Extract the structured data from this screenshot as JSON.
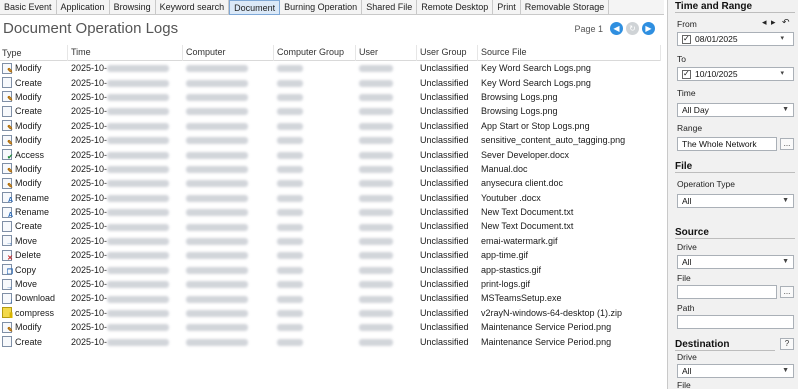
{
  "tabs": [
    "Basic Event",
    "Application",
    "Browsing",
    "Keyword search",
    "Document",
    "Burning Operation",
    "Shared File",
    "Remote Desktop",
    "Print",
    "Removable Storage"
  ],
  "active_tab_index": 4,
  "page_title": "Document Operation Logs",
  "pager": {
    "label": "Page 1"
  },
  "columns": [
    "Type",
    "Time",
    "Computer",
    "Computer Group",
    "User",
    "User Group",
    "Source File"
  ],
  "rows": [
    {
      "type": "Modify",
      "icon": "modify-icon",
      "time": "2025-10-",
      "user_group": "Unclassified",
      "source_file": "Key Word Search Logs.png"
    },
    {
      "type": "Create",
      "icon": "create-icon",
      "time": "2025-10-",
      "user_group": "Unclassified",
      "source_file": "Key Word Search Logs.png"
    },
    {
      "type": "Modify",
      "icon": "modify-icon",
      "time": "2025-10-",
      "user_group": "Unclassified",
      "source_file": "Browsing Logs.png"
    },
    {
      "type": "Create",
      "icon": "create-icon",
      "time": "2025-10-",
      "user_group": "Unclassified",
      "source_file": "Browsing Logs.png"
    },
    {
      "type": "Modify",
      "icon": "modify-icon",
      "time": "2025-10-",
      "user_group": "Unclassified",
      "source_file": "App Start or Stop Logs.png"
    },
    {
      "type": "Modify",
      "icon": "modify-icon",
      "time": "2025-10-",
      "user_group": "Unclassified",
      "source_file": "sensitive_content_auto_tagging.png"
    },
    {
      "type": "Access",
      "icon": "access-icon",
      "time": "2025-10-",
      "user_group": "Unclassified",
      "source_file": "Sever Developer.docx"
    },
    {
      "type": "Modify",
      "icon": "modify-icon",
      "time": "2025-10-",
      "user_group": "Unclassified",
      "source_file": "Manual.doc"
    },
    {
      "type": "Modify",
      "icon": "modify-icon",
      "time": "2025-10-",
      "user_group": "Unclassified",
      "source_file": "anysecura client.doc"
    },
    {
      "type": "Rename",
      "icon": "rename-icon",
      "time": "2025-10-",
      "user_group": "Unclassified",
      "source_file": "Youtuber .docx"
    },
    {
      "type": "Rename",
      "icon": "rename-icon",
      "time": "2025-10-",
      "user_group": "Unclassified",
      "source_file": "New Text Document.txt"
    },
    {
      "type": "Create",
      "icon": "create-icon",
      "time": "2025-10-",
      "user_group": "Unclassified",
      "source_file": "New Text Document.txt"
    },
    {
      "type": "Move",
      "icon": "move-icon",
      "time": "2025-10-",
      "user_group": "Unclassified",
      "source_file": "emai-watermark.gif"
    },
    {
      "type": "Delete",
      "icon": "delete-icon",
      "time": "2025-10-",
      "user_group": "Unclassified",
      "source_file": "app-time.gif"
    },
    {
      "type": "Copy",
      "icon": "copy-icon",
      "time": "2025-10-",
      "user_group": "Unclassified",
      "source_file": "app-stastics.gif"
    },
    {
      "type": "Move",
      "icon": "move-icon",
      "time": "2025-10-",
      "user_group": "Unclassified",
      "source_file": "print-logs.gif"
    },
    {
      "type": "Download",
      "icon": "download-icon",
      "time": "2025-10-",
      "user_group": "Unclassified",
      "source_file": "MSTeamsSetup.exe"
    },
    {
      "type": "compress",
      "icon": "compress-icon",
      "time": "2025-10-",
      "user_group": "Unclassified",
      "source_file": "v2rayN-windows-64-desktop (1).zip"
    },
    {
      "type": "Modify",
      "icon": "modify-icon",
      "time": "2025-10-",
      "user_group": "Unclassified",
      "source_file": "Maintenance Service Period.png"
    },
    {
      "type": "Create",
      "icon": "create-icon",
      "time": "2025-10-",
      "user_group": "Unclassified",
      "source_file": "Maintenance Service Period.png"
    }
  ],
  "panel": {
    "time_range": {
      "heading": "Time and Range",
      "from_label": "From",
      "from_value": "08/01/2025",
      "to_label": "To",
      "to_value": "10/10/2025",
      "time_label": "Time",
      "time_value": "All Day",
      "range_label": "Range",
      "range_value": "The Whole Network",
      "browse_label": "..."
    },
    "file": {
      "heading": "File",
      "operation_type_label": "Operation Type",
      "operation_type_value": "All"
    },
    "source": {
      "heading": "Source",
      "drive_label": "Drive",
      "drive_value": "All",
      "file_label": "File",
      "file_value": "",
      "browse_label": "...",
      "path_label": "Path",
      "path_value": ""
    },
    "destination": {
      "heading": "Destination",
      "help_label": "?",
      "drive_label": "Drive",
      "drive_value": "All",
      "file_label": "File"
    }
  },
  "colors": {
    "accent": "#2f8fe0",
    "active_tab": "#dbe9f8",
    "panel_bg": "#f1f1f1"
  }
}
